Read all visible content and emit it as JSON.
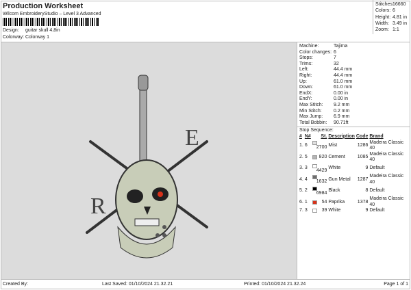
{
  "header": {
    "title": "Production Worksheet",
    "subtitle": "Wilcom EmbroideryStudio – Level 3 Advanced",
    "design_label": "Design:",
    "design": "guitar skull 4,8in",
    "colorway_label": "Colorway:",
    "colorway": "Colorway 1"
  },
  "stats": [
    {
      "k": "Stitches:",
      "v": "16660"
    },
    {
      "k": "Colors:",
      "v": "6"
    },
    {
      "k": "Height:",
      "v": "4.81 in"
    },
    {
      "k": "Width:",
      "v": "3.49 in"
    },
    {
      "k": "Zoom:",
      "v": "1:1"
    }
  ],
  "details": [
    {
      "k": "Machine:",
      "v": "Tajima"
    },
    {
      "k": "Color changes:",
      "v": "6"
    },
    {
      "k": "Stops:",
      "v": "7"
    },
    {
      "k": "Trims:",
      "v": "32"
    },
    {
      "k": "Left:",
      "v": "44.4 mm"
    },
    {
      "k": "Right:",
      "v": "44.4 mm"
    },
    {
      "k": "Up:",
      "v": "61.0 mm"
    },
    {
      "k": "Down:",
      "v": "61.0 mm"
    },
    {
      "k": "EndX:",
      "v": "0.00 in"
    },
    {
      "k": "EndY:",
      "v": "0.00 in"
    },
    {
      "k": "Max Stitch:",
      "v": "9.2 mm"
    },
    {
      "k": "Min Stitch:",
      "v": "0.2 mm"
    },
    {
      "k": "Max Jump:",
      "v": "6.9 mm"
    },
    {
      "k": "Total Bobbin:",
      "v": "90.71ft"
    }
  ],
  "sequence": {
    "title": "Stop Sequence:",
    "headers": [
      "#",
      "N#",
      "St.",
      "Description",
      "Code",
      "Brand"
    ],
    "rows": [
      {
        "n": "1.",
        "nn": "6",
        "color": "#e0e0e0",
        "st": "2700",
        "desc": "Mist",
        "code": "1286",
        "brand": "Madeira Classic 40"
      },
      {
        "n": "2.",
        "nn": "5",
        "color": "#b5b5b5",
        "st": "820",
        "desc": "Cement",
        "code": "1085",
        "brand": "Madeira Classic 40"
      },
      {
        "n": "3.",
        "nn": "3",
        "color": "#ffffff",
        "st": "4429",
        "desc": "White",
        "code": "9",
        "brand": "Default"
      },
      {
        "n": "4.",
        "nn": "4",
        "color": "#6e6e6e",
        "st": "1632",
        "desc": "Gun Metal",
        "code": "1287",
        "brand": "Madeira Classic 40"
      },
      {
        "n": "5.",
        "nn": "2",
        "color": "#000000",
        "st": "6984",
        "desc": "Black",
        "code": "8",
        "brand": "Default"
      },
      {
        "n": "6.",
        "nn": "1",
        "color": "#d8321a",
        "st": "54",
        "desc": "Paprika",
        "code": "1378",
        "brand": "Madeira Classic 40"
      },
      {
        "n": "7.",
        "nn": "3",
        "color": "#ffffff",
        "st": "39",
        "desc": "White",
        "code": "9",
        "brand": "Default"
      }
    ]
  },
  "footer": {
    "created": "Created By:",
    "saved": "Last Saved: 01/10/2024 21.32.21",
    "printed": "Printed: 01/10/2024 21.32.24",
    "page": "Page 1 of 1"
  }
}
